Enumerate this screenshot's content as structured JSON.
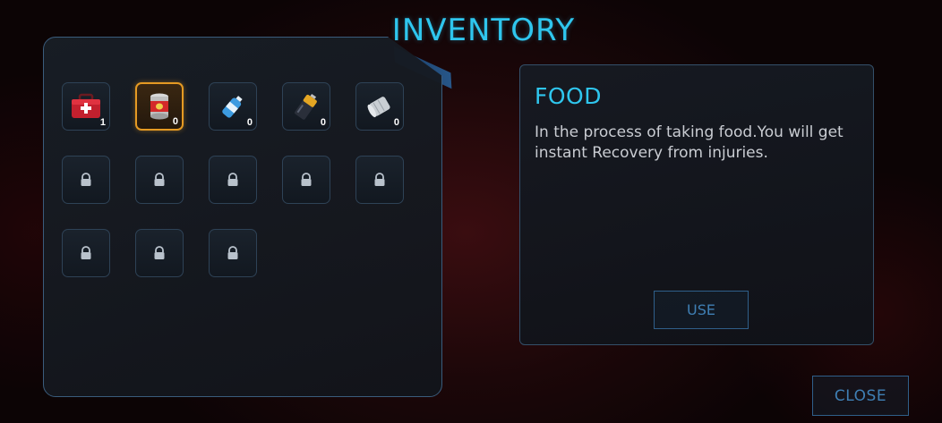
{
  "screen": {
    "title": "INVENTORY"
  },
  "inventory": {
    "items": [
      {
        "icon": "medkit-icon",
        "count": "1",
        "selected": false,
        "locked": false
      },
      {
        "icon": "canned-food-icon",
        "count": "0",
        "selected": true,
        "locked": false
      },
      {
        "icon": "water-bottle-icon",
        "count": "0",
        "selected": false,
        "locked": false
      },
      {
        "icon": "battery-icon",
        "count": "0",
        "selected": false,
        "locked": false
      },
      {
        "icon": "bandage-roll-icon",
        "count": "0",
        "selected": false,
        "locked": false
      },
      {
        "icon": "lock-icon",
        "locked": true
      },
      {
        "icon": "lock-icon",
        "locked": true
      },
      {
        "icon": "lock-icon",
        "locked": true
      },
      {
        "icon": "lock-icon",
        "locked": true
      },
      {
        "icon": "lock-icon",
        "locked": true
      },
      {
        "icon": "lock-icon",
        "locked": true
      },
      {
        "icon": "lock-icon",
        "locked": true
      },
      {
        "icon": "lock-icon",
        "locked": true
      }
    ]
  },
  "details": {
    "title": "FOOD",
    "description": "In the process of taking food.You will get instant Recovery from injuries.",
    "use_label": "USE"
  },
  "footer": {
    "close_label": "CLOSE"
  },
  "colors": {
    "accent": "#2fc6ee",
    "selected_border": "#e59a23",
    "button_text": "#3f7fb4"
  }
}
